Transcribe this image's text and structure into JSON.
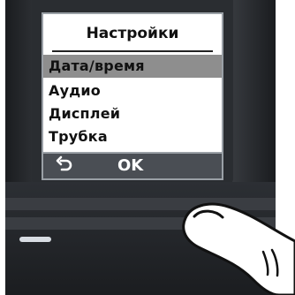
{
  "menu": {
    "title": "Настройки",
    "items": [
      {
        "label": "Дата/время",
        "selected": true
      },
      {
        "label": "Аудио",
        "selected": false
      },
      {
        "label": "Дисплей",
        "selected": false
      },
      {
        "label": "Трубка",
        "selected": false
      }
    ]
  },
  "softkeys": {
    "back": "⟲",
    "ok": "OK"
  },
  "colors": {
    "selection": "#8e8e8e",
    "phone_body": "#2b2e33",
    "softkey_bar": "#4a4e54"
  },
  "icons": {
    "back": "back-arrow-icon",
    "call": "call-key-icon",
    "finger": "pointing-finger-icon"
  }
}
